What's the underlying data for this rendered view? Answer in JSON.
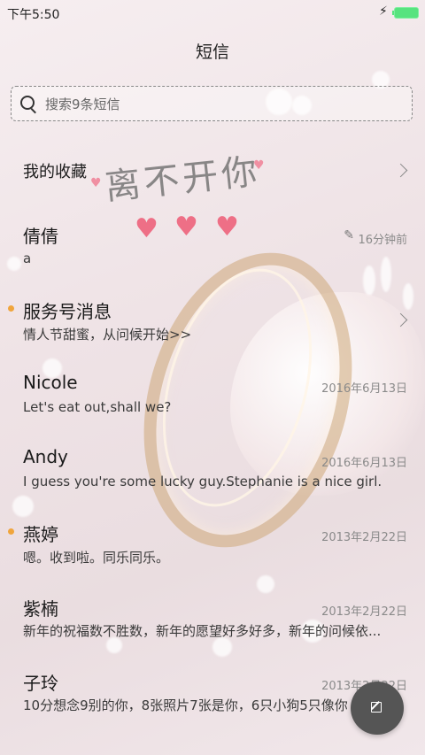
{
  "status_bar": {
    "time": "下午5:50"
  },
  "header": {
    "title": "短信"
  },
  "search": {
    "placeholder": "搜索9条短信"
  },
  "decor": {
    "text": "离不开你"
  },
  "favorites": {
    "label": "我的收藏"
  },
  "threads": [
    {
      "name": "倩倩",
      "preview": "a",
      "time": "16分钟前",
      "draft": true,
      "unread": false
    },
    {
      "name": "服务号消息",
      "preview": "情人节甜蜜，从问候开始>>",
      "time": "",
      "unread": true
    },
    {
      "name": "Nicole",
      "preview": "Let's eat out,shall we?",
      "time": "2016年6月13日",
      "unread": false
    },
    {
      "name": "Andy",
      "preview": "I guess you're some lucky guy.Stephanie is a nice girl.",
      "time": "2016年6月13日",
      "unread": false
    },
    {
      "name": "燕婷",
      "preview": "嗯。收到啦。同乐同乐。",
      "time": "2013年2月22日",
      "unread": true
    },
    {
      "name": "紫楠",
      "preview": "新年的祝福数不胜数，新年的愿望好多好多，新年的问候依...",
      "time": "2013年2月22日",
      "unread": false
    },
    {
      "name": "子玲",
      "preview": "10分想念9别的你，8张照片7张是你，6只小狗5只像你",
      "time": "2013年2月22日",
      "unread": false
    }
  ],
  "colors": {
    "unread_dot": "#f0a53c",
    "fab": "#555555",
    "battery": "#57e37f"
  }
}
